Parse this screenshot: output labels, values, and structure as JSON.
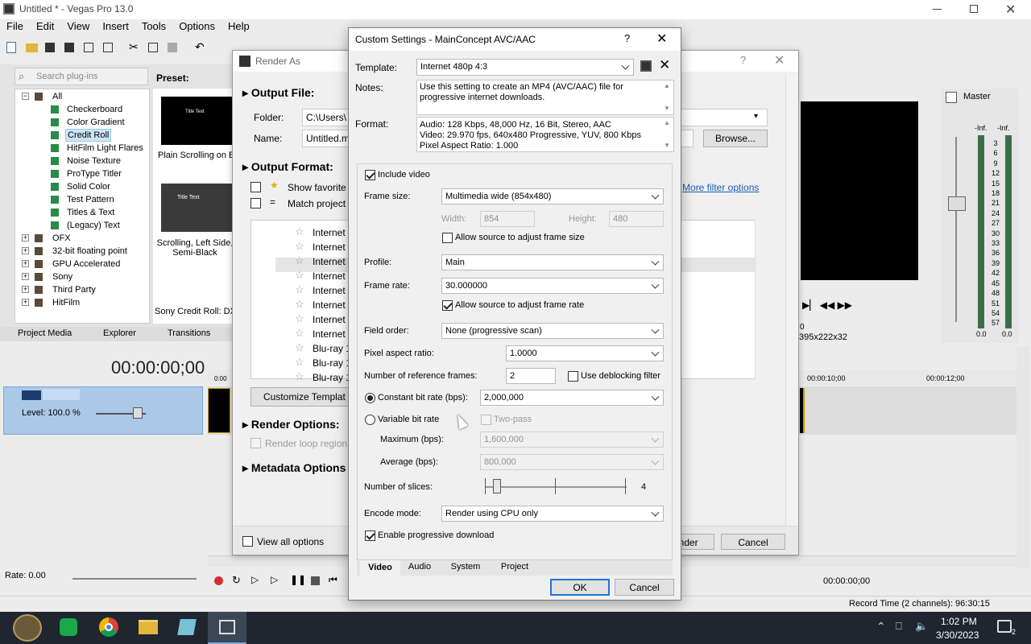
{
  "app": {
    "title": "Untitled * - Vegas Pro 13.0"
  },
  "menu": [
    "File",
    "Edit",
    "View",
    "Insert",
    "Tools",
    "Options",
    "Help"
  ],
  "plugins": {
    "search_placeholder": "Search plug-ins",
    "tree": [
      {
        "label": "All",
        "level": 0,
        "expander": "−"
      },
      {
        "label": "Checkerboard",
        "level": 1
      },
      {
        "label": "Color Gradient",
        "level": 1
      },
      {
        "label": "Credit Roll",
        "level": 1,
        "selected": true
      },
      {
        "label": "HitFilm Light Flares",
        "level": 1
      },
      {
        "label": "Noise Texture",
        "level": 1
      },
      {
        "label": "ProType Titler",
        "level": 1
      },
      {
        "label": "Solid Color",
        "level": 1
      },
      {
        "label": "Test Pattern",
        "level": 1
      },
      {
        "label": "Titles & Text",
        "level": 1
      },
      {
        "label": "(Legacy) Text",
        "level": 1
      },
      {
        "label": "OFX",
        "level": 0,
        "expander": "+"
      },
      {
        "label": "32-bit floating point",
        "level": 0,
        "expander": "+"
      },
      {
        "label": "GPU Accelerated",
        "level": 0,
        "expander": "+"
      },
      {
        "label": "Sony",
        "level": 0,
        "expander": "+"
      },
      {
        "label": "Third Party",
        "level": 0,
        "expander": "+"
      },
      {
        "label": "HitFilm",
        "level": 0,
        "expander": "+"
      }
    ],
    "preset_label": "Preset:",
    "preset1_thumb_title": "Title Text",
    "preset1_name": "Plain Scrolling on Bl",
    "preset2_thumb_title": "Title Text",
    "preset2_name": "Scrolling, Left Side, Semi-Black",
    "status": "Sony Credit Roll: DX"
  },
  "bottom_tabs": [
    "Project Media",
    "Explorer",
    "Transitions"
  ],
  "timecode": "00:00:00;00",
  "track": {
    "level": "Level: 100.0 %"
  },
  "rate": "Rate: 0.00",
  "render_as": {
    "title": "Render As",
    "output_file": "Output File:",
    "folder_label": "Folder:",
    "folder_value": "C:\\Users\\",
    "name_label": "Name:",
    "name_value": "Untitled.mp4",
    "browse": "Browse...",
    "output_format": "Output Format:",
    "show_favorites": "Show favorite",
    "match_project": "Match project",
    "more_filter": "More filter options",
    "format_list": [
      "Internet",
      "Internet",
      "Internet",
      "Internet",
      "Internet",
      "Internet",
      "Internet",
      "Internet",
      "Blu-ray 1",
      "Blu-ray 1",
      "Blu-ray 1",
      "Blu-ray 1"
    ],
    "customize_template": "Customize Templat",
    "render_options": "Render Options:",
    "render_loop": "Render loop region",
    "metadata_options": "Metadata Options",
    "view_all": "View all options",
    "render_btn": "Render",
    "cancel_btn": "Cancel"
  },
  "preview": {
    "res": "395x222x32",
    "zero": "0"
  },
  "master": {
    "label": "Master",
    "inf1": "-Inf.",
    "inf2": "-Inf.",
    "zero1": "0.0",
    "zero2": "0.0",
    "scale": [
      "3",
      "6",
      "9",
      "12",
      "15",
      "18",
      "21",
      "24",
      "27",
      "30",
      "33",
      "36",
      "39",
      "42",
      "45",
      "48",
      "51",
      "54",
      "57"
    ]
  },
  "timeline": {
    "t1": "00:00:10;00",
    "t2": "00:00:12;00",
    "t0": "0:00",
    "time_display": "00:00:00;00",
    "record_time": "Record Time (2 channels): 96:30:15"
  },
  "dialog": {
    "title": "Custom Settings - MainConcept AVC/AAC",
    "template_label": "Template:",
    "template_value": "Internet 480p 4:3",
    "notes_label": "Notes:",
    "notes_value": "Use this setting to create an MP4 (AVC/AAC) file for progressive internet downloads.",
    "format_label": "Format:",
    "format_lines": [
      "Audio: 128 Kbps, 48,000 Hz, 16 Bit, Stereo, AAC",
      "Video: 29.970 fps, 640x480 Progressive, YUV, 800 Kbps",
      "Pixel Aspect Ratio: 1.000"
    ],
    "include_video": "Include video",
    "frame_size_label": "Frame size:",
    "frame_size_value": "Multimedia wide (854x480)",
    "width_label": "Width:",
    "width_value": "854",
    "height_label": "Height:",
    "height_value": "480",
    "allow_frame_size": "Allow source to adjust frame size",
    "profile_label": "Profile:",
    "profile_value": "Main",
    "frame_rate_label": "Frame rate:",
    "frame_rate_value": "30.000000",
    "allow_frame_rate": "Allow source to adjust frame rate",
    "field_order_label": "Field order:",
    "field_order_value": "None (progressive scan)",
    "par_label": "Pixel aspect ratio:",
    "par_value": "1.0000",
    "ref_frames_label": "Number of reference frames:",
    "ref_frames_value": "2",
    "deblocking": "Use deblocking filter",
    "cbr_label": "Constant bit rate (bps):",
    "cbr_value": "2,000,000",
    "vbr_label": "Variable bit rate",
    "two_pass": "Two-pass",
    "max_label": "Maximum (bps):",
    "max_value": "1,600,000",
    "avg_label": "Average (bps):",
    "avg_value": "800,000",
    "slices_label": "Number of slices:",
    "slices_value": "4",
    "encode_label": "Encode mode:",
    "encode_value": "Render using CPU only",
    "progressive": "Enable progressive download",
    "tabs": [
      "Video",
      "Audio",
      "System",
      "Project"
    ],
    "ok": "OK",
    "cancel": "Cancel"
  },
  "taskbar": {
    "time": "1:02 PM",
    "date": "3/30/2023",
    "notif": "2"
  }
}
